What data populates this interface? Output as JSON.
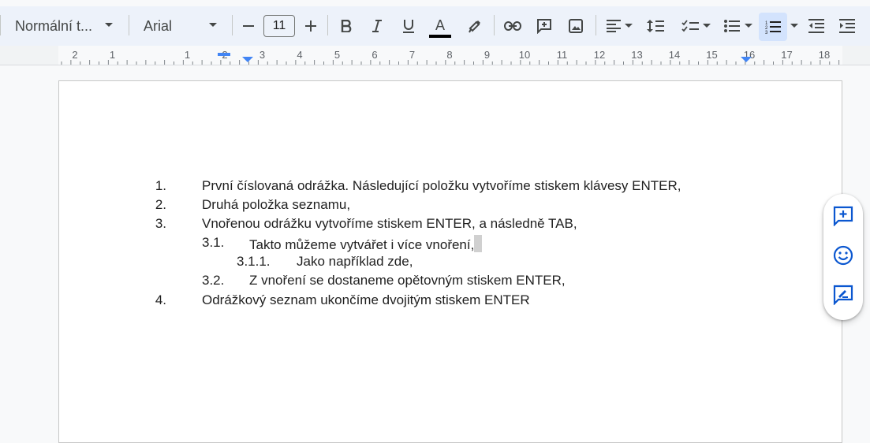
{
  "toolbar": {
    "style_dropdown": "Normální t...",
    "font_dropdown": "Arial",
    "font_size": "11",
    "text_color_label": "A",
    "colors": {
      "text_color_bar": "#000000",
      "icon": "#444746",
      "active_bg": "#d3e3fd",
      "toolbar_bg": "#edf2fa"
    },
    "icons": [
      "chevron-down-icon",
      "minus-icon",
      "plus-icon",
      "bold-icon",
      "italic-icon",
      "underline-icon",
      "text-color-icon",
      "highlight-icon",
      "link-icon",
      "add-comment-icon",
      "image-icon",
      "align-left-icon",
      "line-spacing-icon",
      "checklist-icon",
      "bulleted-list-icon",
      "numbered-list-icon",
      "decrease-indent-icon",
      "increase-indent-icon"
    ]
  },
  "ruler": {
    "labels": [
      "2",
      "1",
      "1",
      "2",
      "3",
      "4",
      "5",
      "6",
      "7",
      "8",
      "9",
      "10",
      "11",
      "12",
      "13",
      "14",
      "15",
      "16",
      "17",
      "18"
    ]
  },
  "document": {
    "items": [
      {
        "marker": "1.",
        "text": "První číslovaná odrážka. Následující položku vytvoříme stiskem klávesy ENTER,"
      },
      {
        "marker": "2.",
        "text": "Druhá položka seznamu,"
      },
      {
        "marker": "3.",
        "text": "Vnořenou odrážku vytvoříme stiskem ENTER, a následně TAB,"
      },
      {
        "marker": "3.1.",
        "text": "Takto můžeme vytvářet i více vnoření,"
      },
      {
        "marker": "3.1.1.",
        "text": "Jako například zde,"
      },
      {
        "marker": "3.2.",
        "text": "Z vnoření se dostaneme opětovným stiskem ENTER,"
      },
      {
        "marker": "4.",
        "text": "Odrážkový seznam ukončíme dvojitým stiskem ENTER"
      }
    ]
  },
  "side_panel": {
    "icons": [
      "add-comment-icon",
      "emoji-reaction-icon",
      "suggest-edits-icon"
    ],
    "accent": "#0b57d0"
  }
}
